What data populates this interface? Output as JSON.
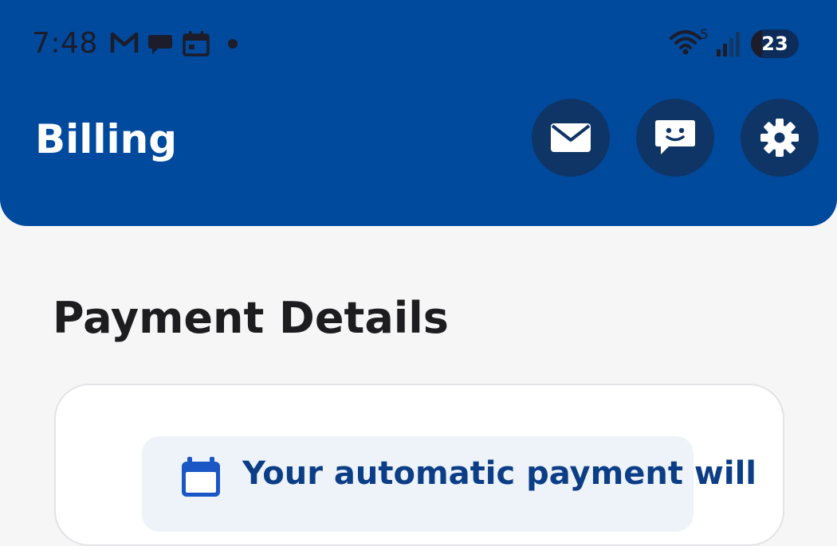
{
  "status_bar": {
    "time": "7:48",
    "notifications": [
      "gmail-icon",
      "chat-bubble-icon",
      "calendar-icon"
    ],
    "wifi_label": "5",
    "battery_level": "23",
    "battery_percent": 23
  },
  "header": {
    "title": "Billing",
    "actions": [
      "mail-icon",
      "chat-icon",
      "settings-icon"
    ]
  },
  "main": {
    "section_title": "Payment Details",
    "notice_text": "Your automatic payment will"
  },
  "colors": {
    "header_bg": "#004a9e",
    "action_button_bg": "#0f3566",
    "page_bg": "#f6f6f7",
    "notice_bg": "#eef3fa",
    "notice_text": "#0b3e86"
  }
}
